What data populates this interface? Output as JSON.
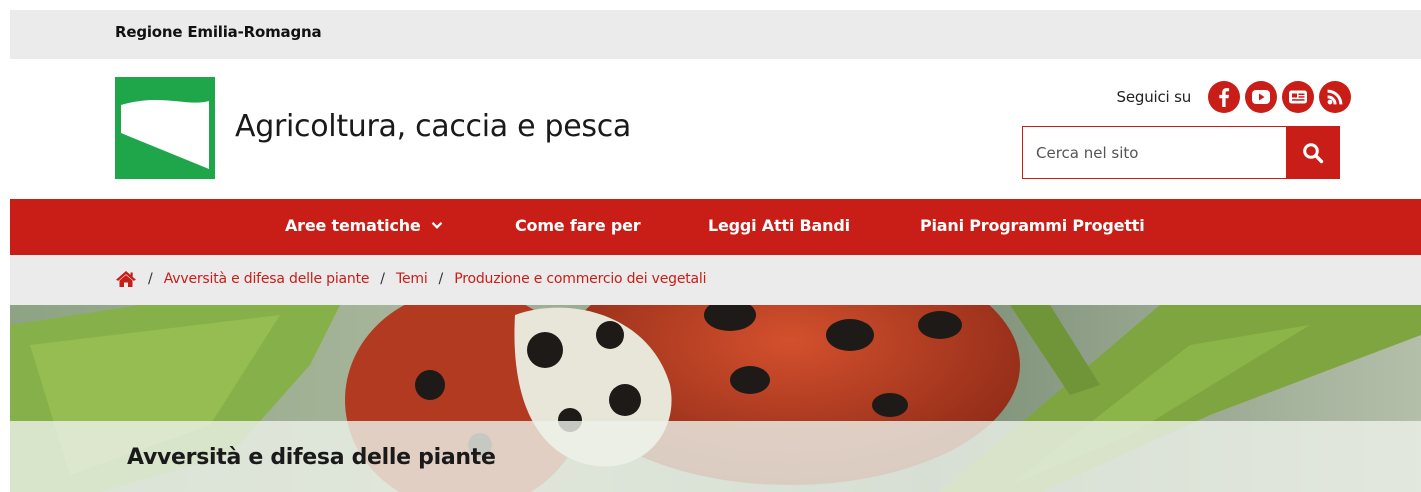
{
  "region": {
    "name": "Regione Emilia-Romagna"
  },
  "header": {
    "site_title": "Agricoltura, caccia e pesca",
    "follow_label": "Seguici su",
    "social": [
      {
        "name": "facebook-icon"
      },
      {
        "name": "youtube-icon"
      },
      {
        "name": "newsletter-icon"
      },
      {
        "name": "rss-icon"
      }
    ],
    "search": {
      "placeholder": "Cerca nel sito",
      "value": ""
    }
  },
  "nav": {
    "items": [
      {
        "label": "Aree tematiche",
        "has_dropdown": true
      },
      {
        "label": "Come fare per",
        "has_dropdown": false
      },
      {
        "label": "Leggi Atti Bandi",
        "has_dropdown": false
      },
      {
        "label": "Piani Programmi Progetti",
        "has_dropdown": false
      }
    ]
  },
  "breadcrumb": {
    "items": [
      {
        "label": "Avversità e difesa delle piante"
      },
      {
        "label": "Temi"
      },
      {
        "label": "Produzione e commercio dei vegetali"
      }
    ]
  },
  "hero": {
    "title": "Avversità e difesa delle piante"
  },
  "colors": {
    "accent": "#c81e17",
    "logo_green": "#1fa64a",
    "topbar": "#ebebeb"
  }
}
